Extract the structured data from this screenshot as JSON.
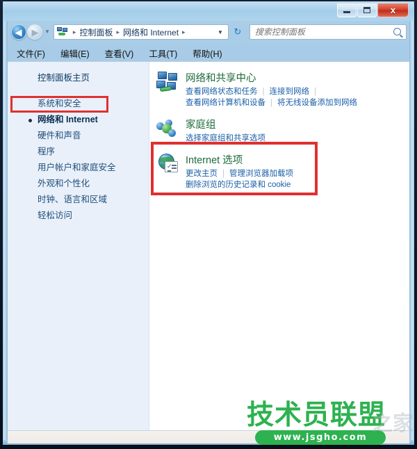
{
  "window": {
    "controls": {
      "minimize": "–",
      "maximize": "□",
      "close": "x"
    }
  },
  "addressbar": {
    "back_arrow": "◀",
    "forward_arrow": "▶",
    "history_chevron": "▼",
    "breadcrumb_icon": "control-panel-icon",
    "crumbs": [
      "控制面板",
      "网络和 Internet"
    ],
    "separator": "▸",
    "dropdown_chevron": "▼",
    "refresh_glyph": "↻"
  },
  "search": {
    "placeholder": "搜索控制面板",
    "value": "",
    "icon": "search-icon"
  },
  "menubar": {
    "items": [
      {
        "label": "文件(F)"
      },
      {
        "label": "编辑(E)"
      },
      {
        "label": "查看(V)"
      },
      {
        "label": "工具(T)"
      },
      {
        "label": "帮助(H)"
      }
    ]
  },
  "sidebar": {
    "home_label": "控制面板主页",
    "items": [
      {
        "label": "系统和安全",
        "selected": false
      },
      {
        "label": "网络和 Internet",
        "selected": true
      },
      {
        "label": "硬件和声音",
        "selected": false
      },
      {
        "label": "程序",
        "selected": false
      },
      {
        "label": "用户帐户和家庭安全",
        "selected": false
      },
      {
        "label": "外观和个性化",
        "selected": false
      },
      {
        "label": "时钟、语言和区域",
        "selected": false
      },
      {
        "label": "轻松访问",
        "selected": false
      }
    ]
  },
  "content": {
    "categories": [
      {
        "icon": "network-sharing-center-icon",
        "title": "网络和共享中心",
        "link_rows": [
          [
            "查看网络状态和任务",
            "连接到网络"
          ],
          [
            "查看网络计算机和设备",
            "将无线设备添加到网络"
          ]
        ]
      },
      {
        "icon": "homegroup-icon",
        "title": "家庭组",
        "link_rows": [
          [
            "选择家庭组和共享选项"
          ]
        ]
      },
      {
        "icon": "internet-options-icon",
        "title": "Internet 选项",
        "link_rows": [
          [
            "更改主页",
            "管理浏览器加载项"
          ],
          [
            "删除浏览的历史记录和 cookie"
          ]
        ]
      }
    ]
  },
  "annotations": {
    "highlight_color": "#e03030",
    "sidebar_highlight_target": "网络和 Internet",
    "content_highlight_target": "Internet 选项"
  },
  "watermark": {
    "brand": "技术员联盟",
    "url": "www.jsgho.com",
    "ghost": "之家",
    "color": "#2db24f"
  }
}
